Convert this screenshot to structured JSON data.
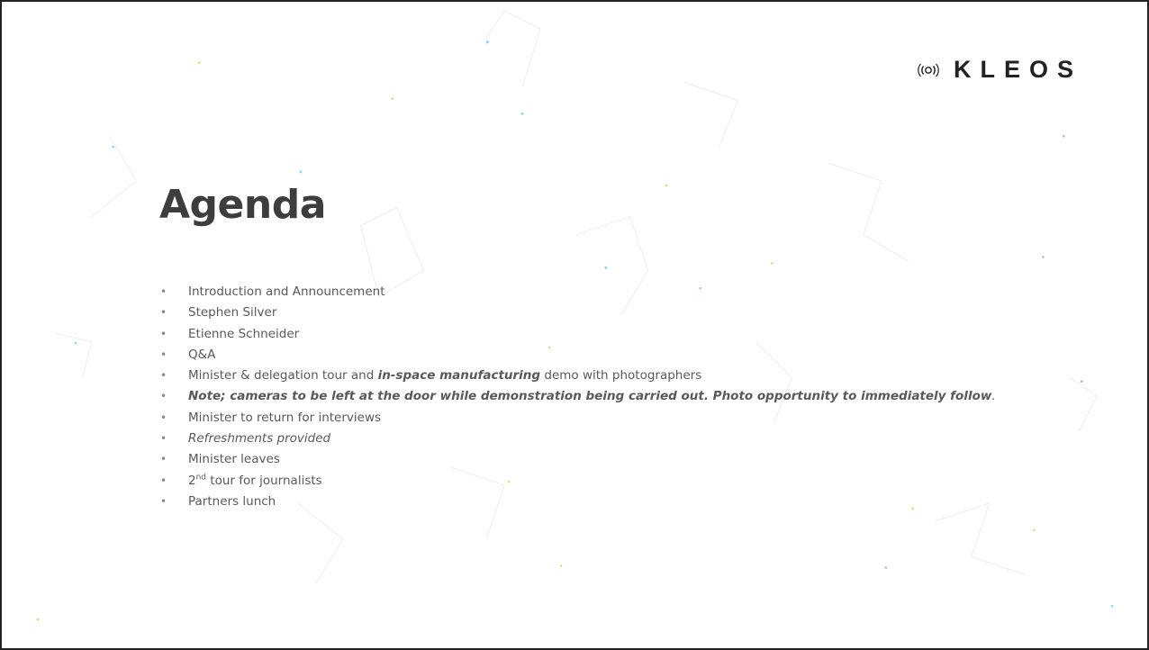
{
  "brand": {
    "name": "KLEOS",
    "icon": "kleos-logo-icon"
  },
  "title": "Agenda",
  "agenda": {
    "item1": "Introduction and Announcement",
    "item2": "Stephen Silver",
    "item3": "Etienne Schneider",
    "item4": "Q&A",
    "item5": {
      "pre": "Minister & delegation tour and ",
      "emphasis": "in-space manufacturing",
      "post": " demo with photographers"
    },
    "item6": {
      "emphasis": "Note; cameras to be left at the door while demonstration being carried out. Photo opportunity to immediately follow",
      "post": "."
    },
    "item7": "Minister to return for interviews",
    "item8": "Refreshments provided",
    "item9": "Minister leaves",
    "item10": {
      "number": "2",
      "suffix": "nd",
      "text": " tour for journalists"
    },
    "item11": "Partners lunch"
  },
  "colors": {
    "title": "#3d3d3d",
    "body_text": "#595959",
    "bullet": "#8a8a8a",
    "logo": "#222222",
    "background": "#ffffff",
    "network_dots": [
      "#8fd3f4",
      "#f3d36b",
      "#a9b8f0",
      "#c7e89a"
    ]
  }
}
